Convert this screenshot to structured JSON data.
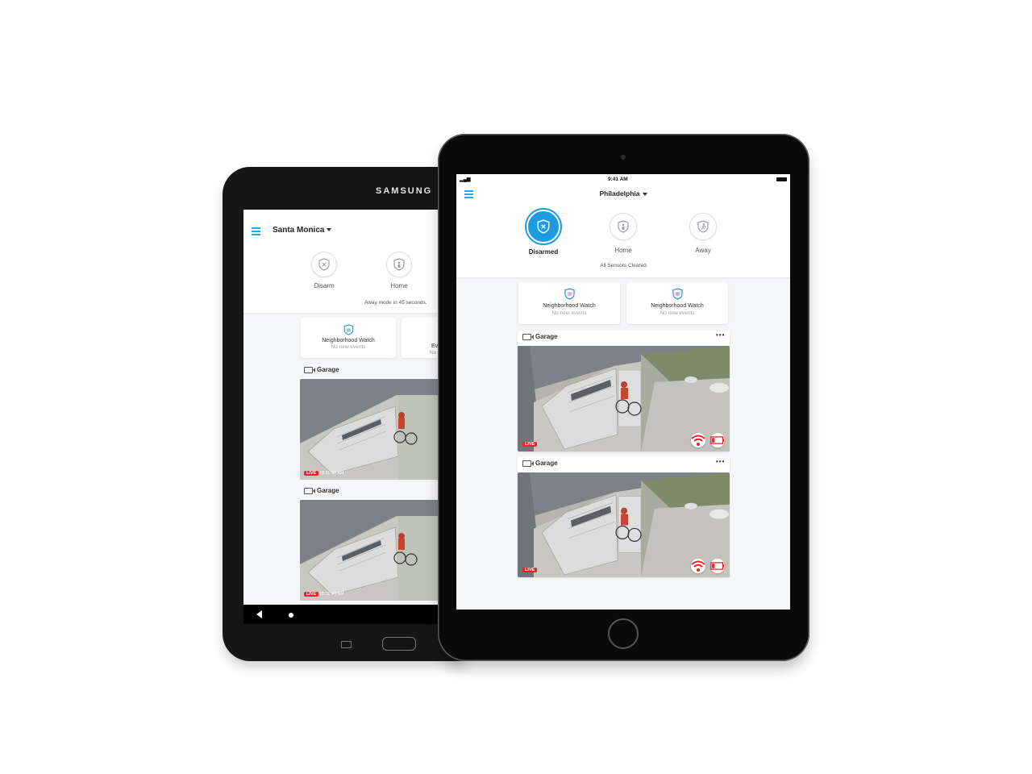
{
  "android": {
    "brand": "SAMSUNG",
    "location": "Santa Monica",
    "modes": [
      {
        "label": "Disarm"
      },
      {
        "label": "Home"
      }
    ],
    "status": "Away mode in 45 seconds.",
    "cards": [
      {
        "title": "Neighborhood Watch",
        "subtitle": "No new events"
      },
      {
        "title": "Ev",
        "subtitle": "No"
      }
    ],
    "cameras": [
      {
        "name": "Garage",
        "live": "LIVE",
        "time": "18:11:00 AM"
      },
      {
        "name": "Garage",
        "live": "LIVE",
        "time": "18:11:00 AM"
      }
    ]
  },
  "ipad": {
    "time": "9:41 AM",
    "location": "Philadelphia",
    "modes": [
      {
        "label": "Disarmed",
        "active": true
      },
      {
        "label": "Home"
      },
      {
        "label": "Away"
      }
    ],
    "status": "All Sensors Cleared",
    "cards": [
      {
        "title": "Neighborhood Watch",
        "subtitle": "No new events"
      },
      {
        "title": "Neighborhood Watch",
        "subtitle": "No new events"
      }
    ],
    "cameras": [
      {
        "name": "Garage",
        "more": "•••",
        "live": "LIVE"
      },
      {
        "name": "Garage",
        "more": "•••",
        "live": "LIVE"
      }
    ]
  },
  "colors": {
    "accent": "#1c9be0",
    "live": "#e3262c",
    "background": "#f5f6f8"
  }
}
